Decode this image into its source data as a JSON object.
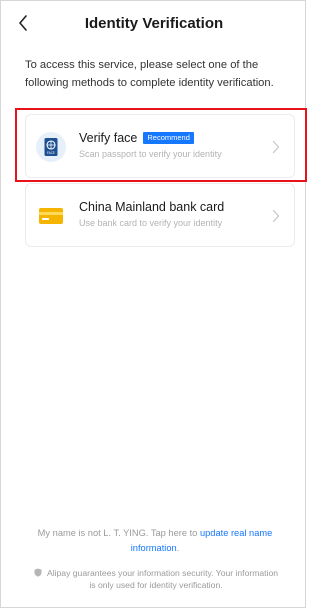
{
  "header": {
    "title": "Identity Verification",
    "back_icon": "chevron-left-icon"
  },
  "intro": {
    "text": "To access this service, please select one of the following methods to complete identity verification."
  },
  "methods": [
    {
      "title": "Verify face",
      "badge": "Recommend",
      "subtitle": "Scan passport to verify your identity",
      "icon": "passport-icon",
      "icon_label": "FACE",
      "highlighted": true
    },
    {
      "title": "China Mainland bank card",
      "subtitle": "Use bank card to verify your identity",
      "icon": "bank-card-icon"
    }
  ],
  "footer": {
    "name_prefix": "My name is not L. T. YING. Tap here to ",
    "name_link": "update real name information",
    "name_suffix": ".",
    "security_text": "Alipay guarantees your information security. Your information is only used for identity verification."
  },
  "colors": {
    "accent": "#1677ff",
    "highlight_border": "#e8131a",
    "card_gold": "#f5b400"
  }
}
